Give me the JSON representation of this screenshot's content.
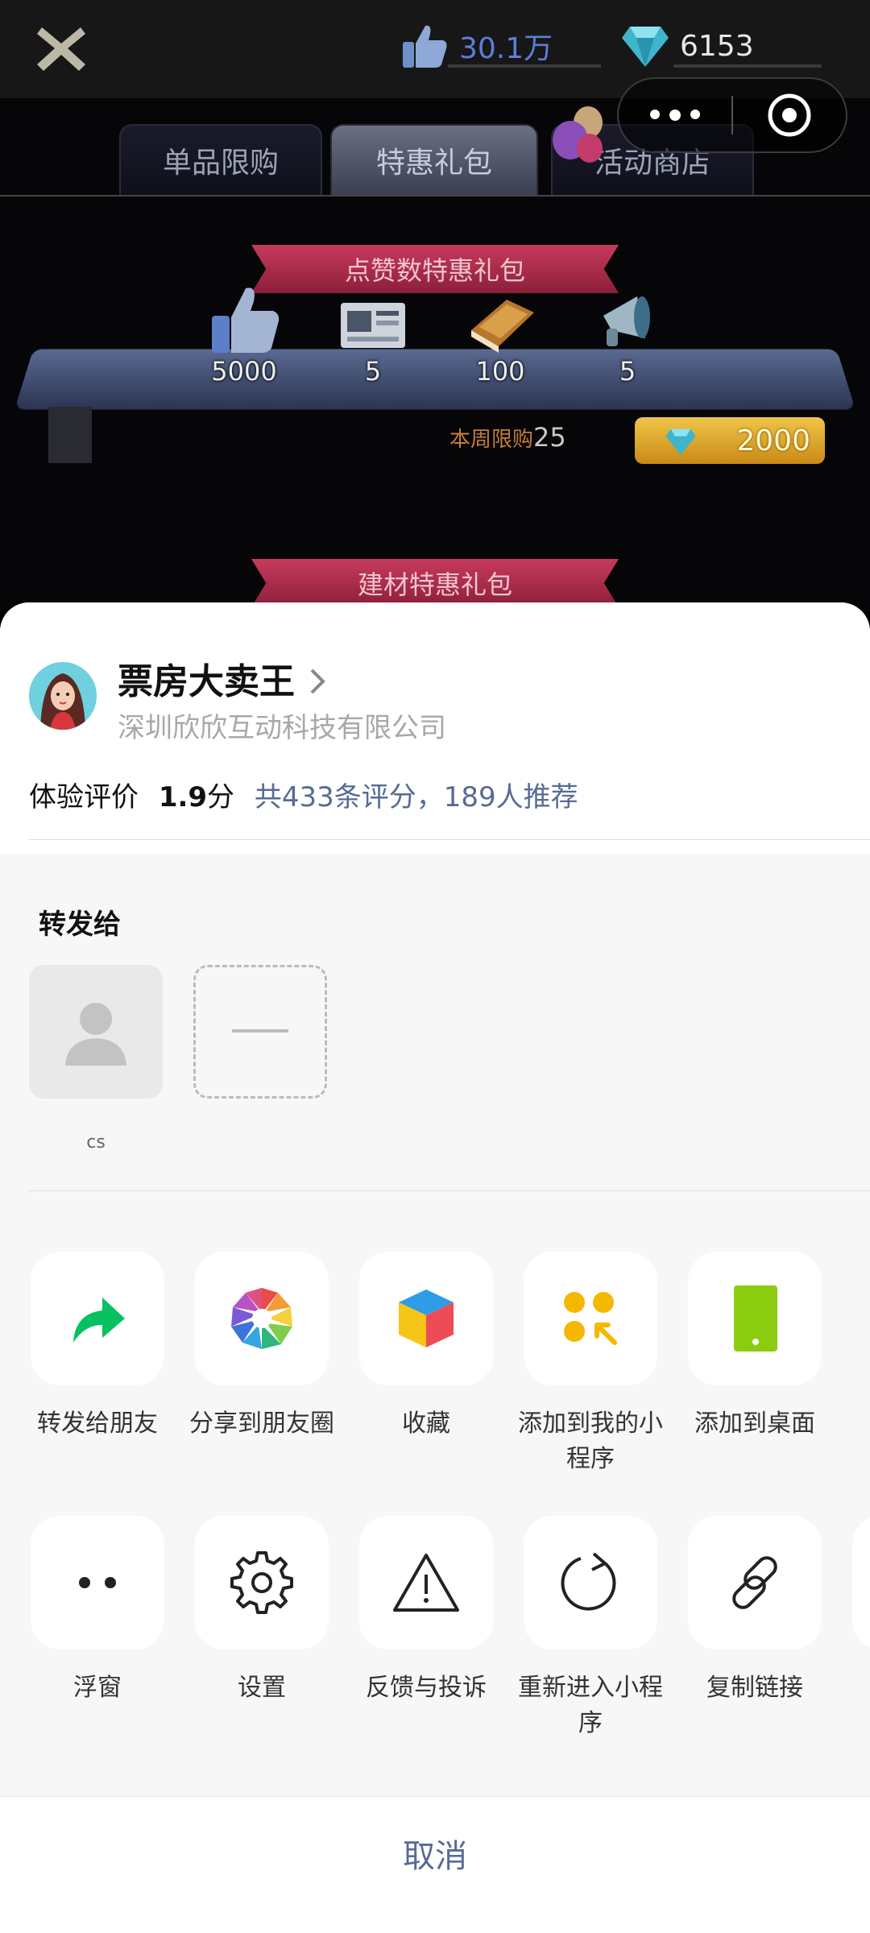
{
  "game": {
    "likes": "30.1万",
    "diamonds": "6153",
    "tabs": [
      "单品限购",
      "特惠礼包",
      "活动商店"
    ],
    "pack1": {
      "title": "点赞数特惠礼包",
      "items": [
        {
          "icon": "thumbs-up-icon",
          "qty": "5000"
        },
        {
          "icon": "newspaper-icon",
          "qty": "5"
        },
        {
          "icon": "book-icon",
          "qty": "100"
        },
        {
          "icon": "megaphone-icon",
          "qty": "5"
        }
      ],
      "weekly_label": "本周限购",
      "weekly_count": "25",
      "price": "2000"
    },
    "pack2": {
      "title": "建材特惠礼包"
    }
  },
  "sheet": {
    "app_name": "票房大卖王",
    "company": "深圳欣欣互动科技有限公司",
    "rating_label": "体验评价",
    "rating_score": "1.9",
    "rating_unit": "分",
    "rating_detail": "共433条评分，189人推荐",
    "forward_title": "转发给",
    "contacts": [
      {
        "name": "cs"
      }
    ],
    "actions_row1": [
      {
        "label": "转发给朋友"
      },
      {
        "label": "分享到朋友圈"
      },
      {
        "label": "收藏"
      },
      {
        "label": "添加到我的小程序"
      },
      {
        "label": "添加到桌面"
      }
    ],
    "actions_row2": [
      {
        "label": "浮窗"
      },
      {
        "label": "设置"
      },
      {
        "label": "反馈与投诉"
      },
      {
        "label": "重新进入小程序"
      },
      {
        "label": "复制链接"
      }
    ],
    "cancel": "取消",
    "colors": {
      "link": "#576b95",
      "green": "#07c160"
    }
  }
}
